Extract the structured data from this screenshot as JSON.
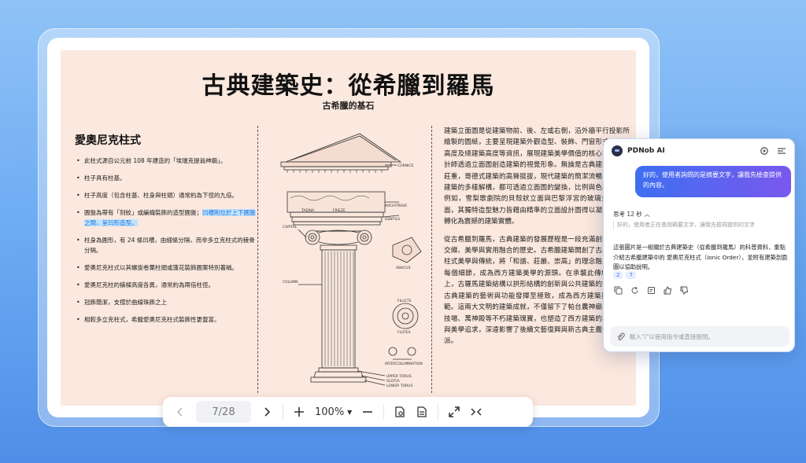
{
  "document": {
    "title": "古典建築史：從希臘到羅馬",
    "subtitle": "古希臘的基石",
    "left_column": {
      "heading": "愛奧尼克柱式",
      "bullets": [
        "此柱式源自公元前 108 年建造的「埃瑞克提翁神廟」。",
        "柱子具有柱基。",
        "柱子高度（包含柱基、柱身與柱頭）通常約為下徑的九倍。",
        "圓盤為帶有「刻紋」或編織裝飾的造型圓盤；",
        "柱身為圓形，有 24 條凹槽，由細條分隔，而非多立克柱式的稜骨分隔。",
        "愛奧尼克柱式以其螺旋卷葉柱頭或蓮花裝飾圓案特別著稱。",
        "愛奧尼克柱的橫樑高度各異，通常約為兩倍柱徑。",
        "冠飾簡潔，支撐於曲線珠飾之上",
        "相較多立克柱式，希臘愛奧尼克柱式裝飾性更豐富。"
      ],
      "highlight": "凹槽則位於上下圓盤之間，呈凹形造型。"
    },
    "figure_labels": {
      "cornice": "CORNICE",
      "frieze": "FRIEZE",
      "architrave": "ARCHITRAVE",
      "capital": "CAPITAL",
      "column": "COLUMN",
      "abacus": "ABACUS",
      "fillets": "FILLETS",
      "flutes": "FLUTES",
      "intercolumniation": "INTERCOLUMNIATION",
      "upper_torus": "UPPER TORUS",
      "scotia": "SCOTIA",
      "lower_torus": "LOWER TORUS",
      "taenia": "TAENIA",
      "dentils": "DENTILS"
    },
    "right_column": [
      "建築立面圖是從建築物前、後、左或右側，沿外牆平行投影所繪製的圖紙，主要呈現建築外觀造型、裝飾、門窗形式、樓層高度及總建築高度等資訊，展現建築美學價值的核心載體。設計師透過立面圖創造建築的視覺形象。無論是古典建築的對稱莊重，哥德式建築的高聳挺拔，現代建築的簡潔流暢，或當代建築的多樣解構，都可透過立面圖的變換，比例與色彩呈現。例如，雪梨歌劇院的貝殼狀立面與巴黎浮宮的玻璃金字塔立面，其獨特造型魅力皆藉由精準的立面設計圖得以凝固，最終轉化為震撼的建築實體。",
      "從古希臘到羅馬，古典建築的發展歷程是一段充滿創新與創新交織、美學與實用融合的歷史。古希臘建築開創了古典建築的柱式美學與傳統，將「和諧、莊嚴、崇高」的理念融入建築的每個細節，成為西方建築美學的源頭。在承襲此傳統的基礎上，古羅馬建築結構以拱形結構的創新與公共建築的擴展，將古典建築的藝術與功能發揮至極致，成為西方建築技術的典範。這兩大文明的建築成就，不僅留下了帕台農神廟、羅馬競技場、萬神殿等不朽建築瑰寶，也塑造了西方建築的基本範式與美學追求，深遠影響了後續文藝復興與新古典主義等建築學派。"
    ]
  },
  "toolbar": {
    "page_indicator": "7/28",
    "zoom_label": "100%"
  },
  "ai_panel": {
    "name": "PDNob AI",
    "user_message": "好的，使用者詢問的是摘要文字，讓我先檢查提供的內容。",
    "thinking_label": "思考 12 秒",
    "thinking_detail": "好的，使用者正在查詢摘要文字，讓我先檢視提供的文字",
    "answer": "這張圖片是一組關於古典建築史（從希臘到羅馬）的科普資料，重點介紹古希臘建築中的 愛奧尼克柱式（Ionic Order），並附有建築剖面圖以協助說明。",
    "page_refs": [
      "2",
      "7"
    ],
    "input_placeholder": "輸入\"/\"以使用指令或直接提問。"
  },
  "colors": {
    "background": "#6aa8f2",
    "document_page": "#fbe8de",
    "accent": "#3e6ff1",
    "accent_secondary": "#7a58ee",
    "highlight": "#bfe3ff"
  },
  "icons": {
    "prev": "chevron-left-icon",
    "next": "chevron-right-icon",
    "zoom_in": "plus-icon",
    "zoom_out": "minus-icon",
    "page_view": "page-view-icon",
    "document": "document-icon",
    "fit": "fit-screen-icon",
    "collapse": "collapse-icon",
    "settings": "gear-icon",
    "panel": "sidebar-toggle-icon",
    "copy": "copy-icon",
    "regenerate": "refresh-icon",
    "note": "note-icon",
    "like": "thumbs-up-icon",
    "dislike": "thumbs-down-icon",
    "attach": "paperclip-icon"
  }
}
